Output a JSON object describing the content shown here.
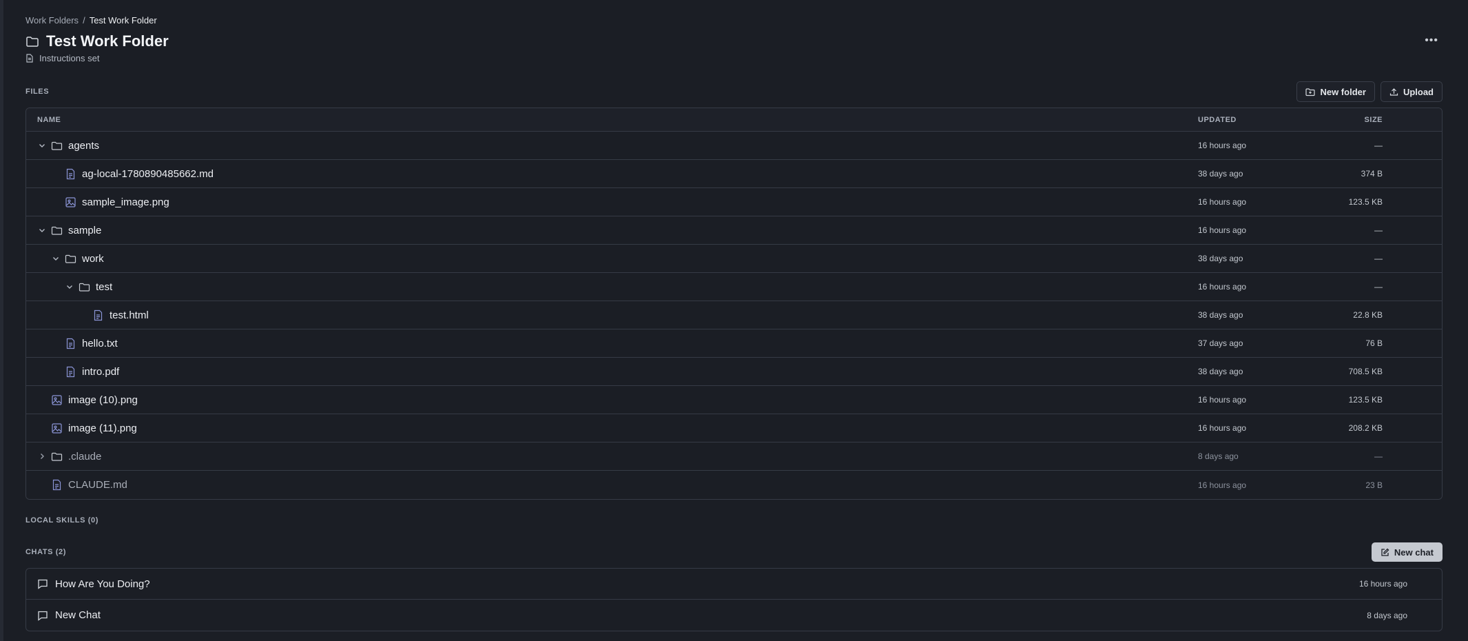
{
  "breadcrumb": {
    "root": "Work Folders",
    "separator": "/",
    "current": "Test Work Folder"
  },
  "header": {
    "title": "Test Work Folder",
    "instructions": "Instructions set",
    "more_label": "•••"
  },
  "files": {
    "section_label": "FILES",
    "new_folder_label": "New folder",
    "upload_label": "Upload",
    "columns": {
      "name": "NAME",
      "updated": "UPDATED",
      "size": "SIZE"
    },
    "rows": [
      {
        "name": "agents",
        "type": "folder",
        "expanded": true,
        "depth": 0,
        "updated": "16 hours ago",
        "size": "—"
      },
      {
        "name": "ag-local-1780890485662.md",
        "type": "file",
        "depth": 1,
        "updated": "38 days ago",
        "size": "374 B"
      },
      {
        "name": "sample_image.png",
        "type": "image",
        "depth": 1,
        "updated": "16 hours ago",
        "size": "123.5 KB"
      },
      {
        "name": "sample",
        "type": "folder",
        "expanded": true,
        "depth": 0,
        "updated": "16 hours ago",
        "size": "—"
      },
      {
        "name": "work",
        "type": "folder",
        "expanded": true,
        "depth": 1,
        "updated": "38 days ago",
        "size": "—"
      },
      {
        "name": "test",
        "type": "folder",
        "expanded": true,
        "depth": 2,
        "updated": "16 hours ago",
        "size": "—"
      },
      {
        "name": "test.html",
        "type": "file",
        "depth": 3,
        "updated": "38 days ago",
        "size": "22.8 KB"
      },
      {
        "name": "hello.txt",
        "type": "file",
        "depth": 1,
        "updated": "37 days ago",
        "size": "76 B"
      },
      {
        "name": "intro.pdf",
        "type": "file",
        "depth": 1,
        "updated": "38 days ago",
        "size": "708.5 KB"
      },
      {
        "name": "image (10).png",
        "type": "image",
        "depth": 0,
        "updated": "16 hours ago",
        "size": "123.5 KB"
      },
      {
        "name": "image (11).png",
        "type": "image",
        "depth": 0,
        "updated": "16 hours ago",
        "size": "208.2 KB"
      },
      {
        "name": ".claude",
        "type": "folder",
        "expanded": false,
        "depth": 0,
        "dim": true,
        "updated": "8 days ago",
        "size": "—"
      },
      {
        "name": "CLAUDE.md",
        "type": "file",
        "depth": 0,
        "dim": true,
        "updated": "16 hours ago",
        "size": "23 B"
      }
    ]
  },
  "skills": {
    "section_label": "LOCAL SKILLS (0)"
  },
  "chats": {
    "section_label": "CHATS (2)",
    "new_chat_label": "New chat",
    "items": [
      {
        "title": "How Are You Doing?",
        "time": "16 hours ago"
      },
      {
        "title": "New Chat",
        "time": "8 days ago"
      }
    ]
  },
  "colors": {
    "background": "#1b1e25",
    "border": "#363b46",
    "file_icon": "#8b95d6"
  }
}
